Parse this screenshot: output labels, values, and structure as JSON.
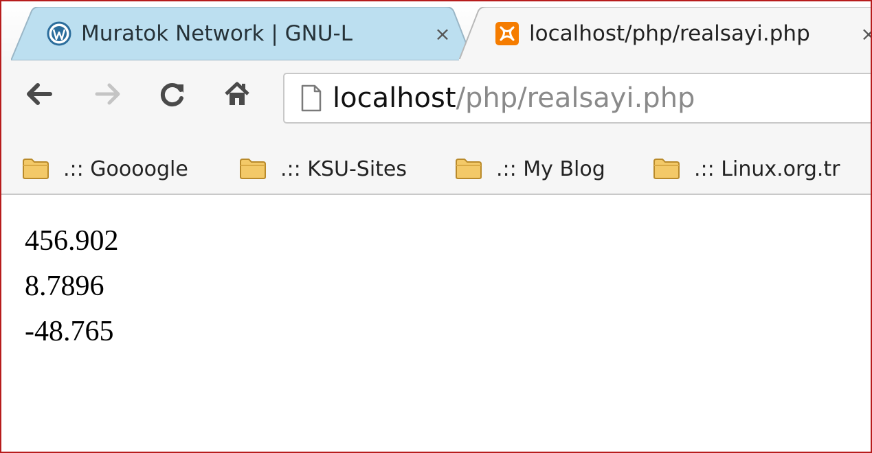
{
  "tabs": [
    {
      "title": "Muratok Network | GNU-L",
      "favicon": "wordpress-icon",
      "active": false
    },
    {
      "title": "localhost/php/realsayi.php",
      "favicon": "xampp-icon",
      "active": true
    }
  ],
  "tab_close_glyph": "×",
  "toolbar": {
    "back_icon": "arrow-left-icon",
    "forward_icon": "arrow-right-icon",
    "reload_icon": "reload-icon",
    "home_icon": "home-icon"
  },
  "address": {
    "host": "localhost",
    "path": "/php/realsayi.php"
  },
  "bookmarks": [
    {
      "label": ".:: Goooogle",
      "icon": "folder-icon"
    },
    {
      "label": ".:: KSU-Sites",
      "icon": "folder-icon"
    },
    {
      "label": ".:: My Blog",
      "icon": "folder-icon"
    },
    {
      "label": ".:: Linux.org.tr",
      "icon": "folder-icon"
    }
  ],
  "content": {
    "lines": [
      "456.902",
      "8.7896",
      "-48.765"
    ]
  },
  "colors": {
    "window_border": "#b71c1c",
    "inactive_tab": "#bcdff0",
    "chrome_bg": "#f6f6f6",
    "url_path": "#8a8a8a",
    "folder": "#f0c058",
    "xampp_orange": "#f57c00"
  }
}
